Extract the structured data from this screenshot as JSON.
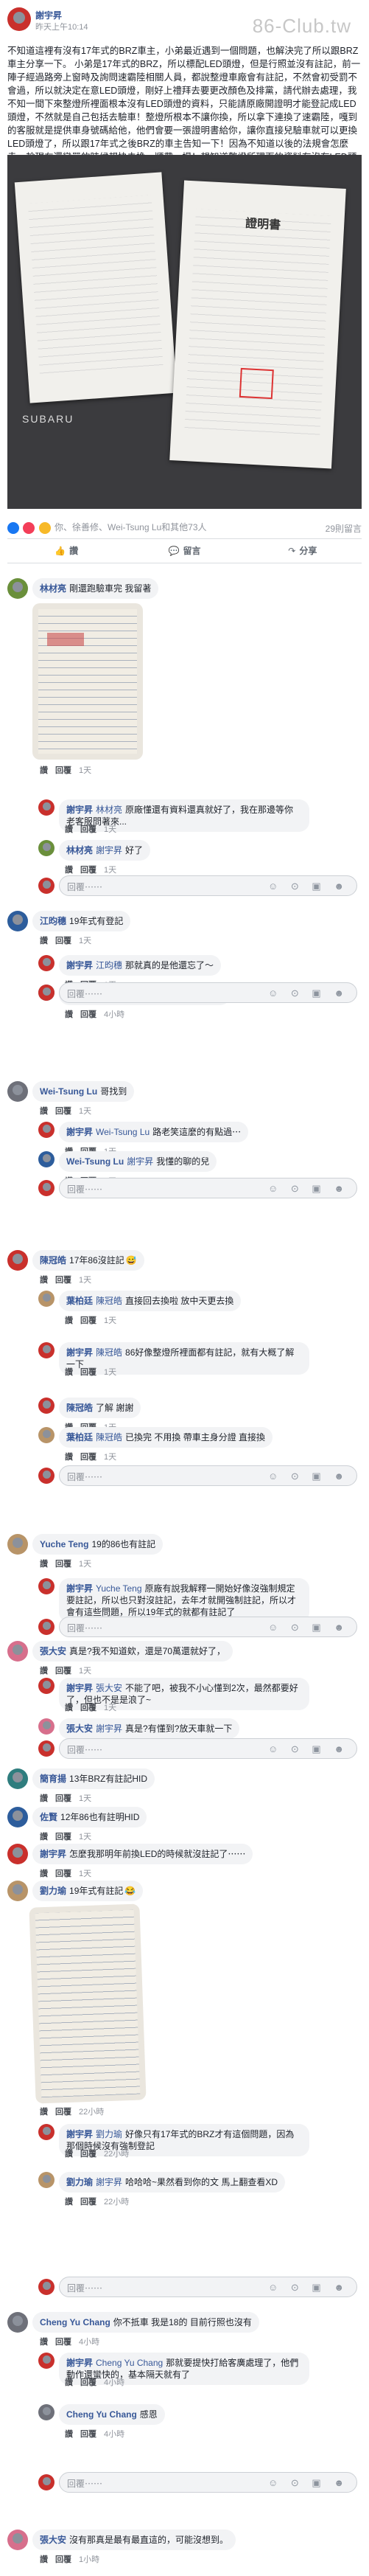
{
  "post": {
    "author": "謝宇昇",
    "time": "昨天上午10:14",
    "watermark": "86-Club.tw",
    "text": "不知道這裡有沒有17年式的BRZ車主，小弟最近遇到一個問題，也解決完了所以跟BRZ車主分享一下。 小弟是17年式的BRZ，所以標配LED頭燈，但是行照並沒有註記，前一陣子經過路旁上窗時及詢問速霸陸相關人員，都說整燈車廠會有註記，不然會初受罰不會過，所以就決定在意LED頭燈，剛好上禮拜去要更改顏色及排黨，請代辦去處理，我不知一間下來整燈所裡面根本沒有LED頭燈的資料，只能請原廠開證明才能登記成LED頭燈，不然就是自己包括去驗車！整燈所根本不讓你換，所以拿下連換了速霸陸，嘎到的客服就是提供車身號碼給他，他們會要一張證明書給你，讓你直接兒驗車就可以更換LED頭燈了，所以跟17年式之後BRZ的車主告知一下！因為不知道以後的法規會怎麼走，趁現在還蠻單的時候趕快去換，順帶一提！想知道整燈所理面的資料有沒有LED頭燈，直接打電話問就好了，不用跑一趟！",
    "brand": "SUBARU",
    "photo_doc_title": "證明書",
    "reactions": {
      "summary": "你、徐善修、Wei-Tsung Lu和其他73人",
      "comments_count": "29則留言",
      "colors": [
        "#1877f2",
        "#f33e58",
        "#f7b928"
      ]
    },
    "actions": {
      "like_icon": "👍",
      "like": "讚",
      "comment_icon": "💬",
      "comment": "留言",
      "share_icon": "↷",
      "share": "分享"
    }
  },
  "ui": {
    "reply_placeholder": "回覆⋯⋯",
    "reply_icons": "☺ ⊙ ▣ ☻"
  },
  "comments": [
    {
      "author": "林材亮",
      "text": "剛還跑驗車完 我留著",
      "like": "讚",
      "reply": "回覆",
      "time": "1天",
      "replies": [
        {
          "author": "謝宇昇",
          "mention": "林材亮",
          "text": "原廠懂還有資料還真就好了，我在那邊等你老客服問著來...",
          "like": "讚",
          "reply": "回覆",
          "time": "1天"
        },
        {
          "author": "林材亮",
          "mention": "謝宇昇",
          "text": "好了",
          "like": "讚",
          "reply": "回覆",
          "time": "1天"
        }
      ]
    },
    {
      "author": "江昀穗",
      "text": "19年式有登記",
      "like": "讚",
      "reply": "回覆",
      "time": "1天",
      "replies": [
        {
          "author": "謝宇昇",
          "mention": "江昀穗",
          "text": "那就真的是他還忘了～",
          "like": "讚",
          "reply": "回覆",
          "time": "1天"
        },
        {
          "author": "Cheng Yu Chang",
          "mention": "江昀穗",
          "text": "19年式的BRZ",
          "like": "讚",
          "reply": "回覆",
          "time": "4小時"
        }
      ]
    },
    {
      "author": "Wei-Tsung Lu",
      "text": "哥找到",
      "like": "讚",
      "reply": "回覆",
      "time": "1天",
      "replies": [
        {
          "author": "謝宇昇",
          "mention": "Wei-Tsung Lu",
          "text": "路老笑這麼的有點過⋯",
          "like": "讚",
          "reply": "回覆",
          "time": "1天"
        },
        {
          "author": "Wei-Tsung Lu",
          "mention": "謝宇昇",
          "text": "我懂的聊的兒",
          "like": "讚",
          "reply": "回覆",
          "time": "1天"
        }
      ]
    },
    {
      "author": "陳冠皓",
      "text": "17年86沒註記",
      "emoji": "😅",
      "like": "讚",
      "reply": "回覆",
      "time": "1天",
      "replies": [
        {
          "author": "葉柏廷",
          "mention": "陳冠皓",
          "text": "直接回去換啦 放中天更去換",
          "like": "讚",
          "reply": "回覆",
          "time": "1天"
        },
        {
          "author": "謝宇昇",
          "mention": "陳冠皓",
          "text": "86好像整燈所裡面都有註記，就有大概了解一下",
          "like": "讚",
          "reply": "回覆",
          "time": "1天"
        },
        {
          "author": "陳冠皓",
          "mention": "",
          "text": "了解 謝謝",
          "like": "讚",
          "reply": "回覆",
          "time": "1天"
        },
        {
          "author": "葉柏廷",
          "mention": "陳冠皓",
          "text": "已換完 不用換 帶車主身分證 直接換",
          "like": "讚",
          "reply": "回覆",
          "time": "1天"
        }
      ]
    },
    {
      "author": "Yuche Teng",
      "text": "19的86也有註記",
      "like": "讚",
      "reply": "回覆",
      "time": "1天",
      "replies": [
        {
          "author": "謝宇昇",
          "mention": "Yuche Teng",
          "text": "原廠有說我解釋一開始好像沒強制規定要註記，所以也只對沒註記，去年才就開強制註記，所以才會有這些問題，所以19年式的就都有註記了",
          "like": "讚",
          "reply": "回覆",
          "time": "1天"
        }
      ]
    },
    {
      "author": "張大安",
      "text": "真是?我不知道欸，還是70萬還就好了，",
      "like": "讚",
      "reply": "回覆",
      "time": "1天",
      "replies": [
        {
          "author": "謝宇昇",
          "mention": "張大安",
          "text": "不能了吧，被我不小心懂到2次，最然都要好了，但也不是是浪了~",
          "like": "讚",
          "reply": "回覆",
          "time": "1天"
        },
        {
          "author": "張大安",
          "mention": "謝宇昇",
          "text": "真是?有懂到?放天車就一下",
          "like": "讚",
          "reply": "回覆",
          "time": "1天"
        }
      ]
    },
    {
      "author": "簡育揚",
      "text": "13年BRZ有註記HID",
      "like": "讚",
      "reply": "回覆",
      "time": "1天",
      "replies": []
    },
    {
      "author": "佐賢",
      "text": "12年86也有註明HID",
      "like": "讚",
      "reply": "回覆",
      "time": "1天",
      "replies": []
    },
    {
      "author": "謝宇昇",
      "text": "怎麼我那明年前換LED的時候就沒註記了⋯⋯",
      "like": "讚",
      "reply": "回覆",
      "time": "1天",
      "replies": []
    },
    {
      "author": "劉力瑜",
      "text": "19年式有註記",
      "emoji": "😂",
      "like": "讚",
      "reply": "回覆",
      "time": "22小時",
      "replies": [
        {
          "author": "謝宇昇",
          "mention": "劉力瑜",
          "text": "好像只有17年式的BRZ才有這個問題，因為那個時候沒有強制登記",
          "like": "讚",
          "reply": "回覆",
          "time": "22小時"
        },
        {
          "author": "劉力瑜",
          "mention": "謝宇昇",
          "text": "哈哈哈~果然看到你的文 馬上翻查看XD",
          "like": "讚",
          "reply": "回覆",
          "time": "22小時"
        }
      ]
    },
    {
      "author": "Cheng Yu Chang",
      "text": "你不抵車 我是18的 目前行照也沒有",
      "like": "讚",
      "reply": "回覆",
      "time": "4小時",
      "replies": [
        {
          "author": "謝宇昇",
          "mention": "Cheng Yu Chang",
          "text": "那就要提快打給客廣處理了，他們動作還蠻快的，基本隔天就有了",
          "like": "讚",
          "reply": "回覆",
          "time": "4小時"
        },
        {
          "author": "Cheng Yu Chang",
          "mention": "",
          "text": "感恩",
          "like": "讚",
          "reply": "回覆",
          "time": "4小時"
        }
      ]
    },
    {
      "author": "張大安",
      "text": "沒有那真是最有最直這的，可能沒想到。",
      "like": "讚",
      "reply": "回覆",
      "time": "1小時",
      "replies": []
    }
  ]
}
